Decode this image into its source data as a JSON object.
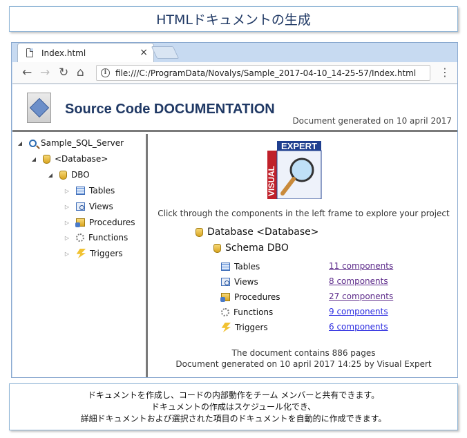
{
  "title": "HTMLドキュメントの生成",
  "browser": {
    "tab_title": "Index.html",
    "tab_close": "×",
    "nav": {
      "back": "←",
      "forward": "→",
      "reload": "↻",
      "home": "⌂",
      "menu": "⋮"
    },
    "info_glyph": "i",
    "url": "file:///C:/ProgramData/Novalys/Sample_2017-04-10_14-25-57/Index.html"
  },
  "doc": {
    "title": "Source Code DOCUMENTATION",
    "generated": "Document generated on 10 april 2017"
  },
  "tree": {
    "server": "Sample_SQL_Server",
    "database": "<Database>",
    "schema": "DBO",
    "items": [
      {
        "label": "Tables",
        "icon": "table-icon"
      },
      {
        "label": "Views",
        "icon": "view-icon"
      },
      {
        "label": "Procedures",
        "icon": "procedure-icon"
      },
      {
        "label": "Functions",
        "icon": "function-icon"
      },
      {
        "label": "Triggers",
        "icon": "trigger-icon"
      }
    ]
  },
  "main": {
    "logo_text_1": "EXPERT",
    "logo_text_2": "VISUAL",
    "intro": "Click through the components in the left frame to explore your project",
    "db_heading": "Database <Database>",
    "schema_heading": "Schema DBO",
    "components": [
      {
        "label": "Tables",
        "link": "11 components"
      },
      {
        "label": "Views",
        "link": "8 components"
      },
      {
        "label": "Procedures",
        "link": "27 components"
      },
      {
        "label": "Functions",
        "link": "9 components"
      },
      {
        "label": "Triggers",
        "link": "6 components"
      }
    ],
    "pages_line": "The document contains  886 pages",
    "generated_line": "Document generated on 10 april 2017 14:25  by Visual Expert"
  },
  "description": {
    "line1": "ドキュメントを作成し、コードの内部動作をチーム メンバーと共有できます。",
    "line2": "ドキュメントの作成はスケジュール化でき、",
    "line3": "詳細ドキュメントおよび選択された項目のドキュメントを自動的に作成できます。"
  }
}
